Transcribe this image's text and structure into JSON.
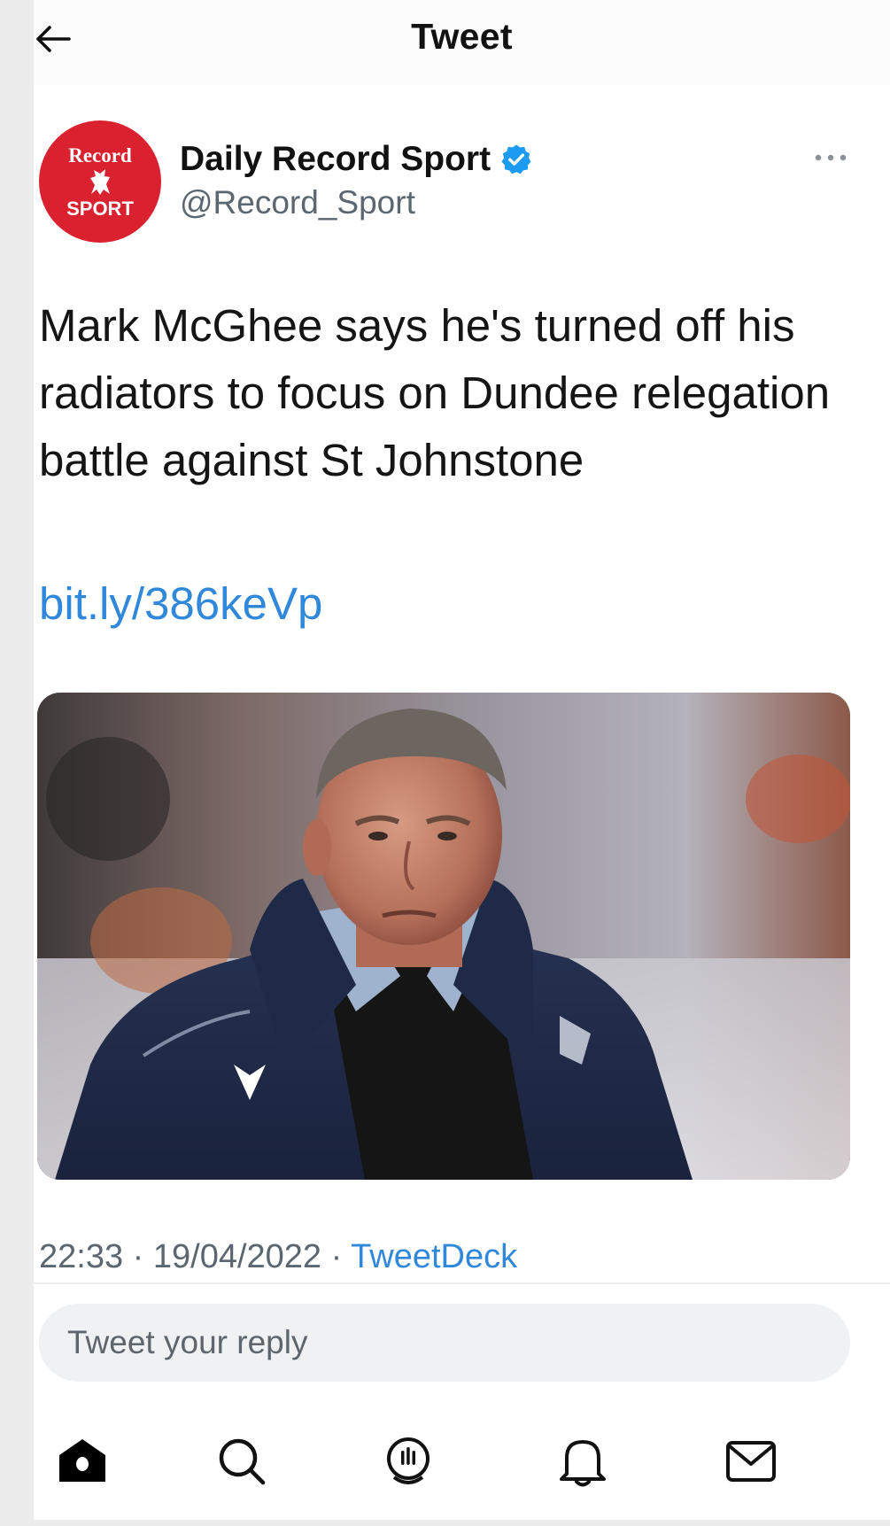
{
  "header": {
    "title": "Tweet",
    "back_icon": "arrow-left-icon"
  },
  "author": {
    "name": "Daily Record Sport",
    "handle": "@Record_Sport",
    "verified": true,
    "avatar_logo_top": "Record",
    "avatar_logo_bottom": "SPORT",
    "avatar_color": "#d9212f"
  },
  "tweet": {
    "text": "Mark McGhee says he's turned off his radiators to focus on Dundee relegation battle against St Johnstone",
    "link": "bit.ly/386keVp",
    "time": "22:33",
    "date": "19/04/2022",
    "source": "TweetDeck",
    "separator": "·"
  },
  "reply": {
    "placeholder": "Tweet your reply"
  },
  "nav": {
    "items": [
      {
        "icon": "home-icon"
      },
      {
        "icon": "search-icon"
      },
      {
        "icon": "spaces-icon"
      },
      {
        "icon": "notifications-bell-icon"
      },
      {
        "icon": "messages-envelope-icon"
      }
    ]
  },
  "colors": {
    "accent": "#2f88d9",
    "verified": "#1d9bf0",
    "text": "#151515",
    "secondary_text": "#5b6670"
  }
}
